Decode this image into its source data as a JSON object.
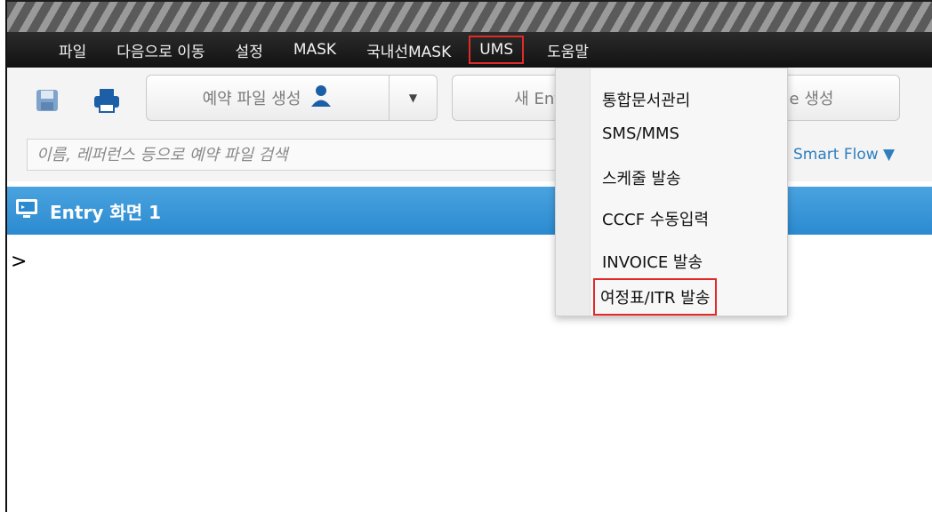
{
  "menubar": {
    "items": [
      "파일",
      "다음으로 이동",
      "설정",
      "MASK",
      "국내선MASK",
      "UMS",
      "도움말"
    ],
    "highlighted": "UMS"
  },
  "toolbar": {
    "reserve_button_label": "예약 파일 생성",
    "new_entry_label": "새 Entr",
    "create_label": "le 생성"
  },
  "search": {
    "placeholder": "이름, 레퍼런스 등으로 예약 파일 검색",
    "smart_flow_label": "Smart Flow ▼"
  },
  "entry": {
    "title": "Entry 화면 1",
    "expander": ">"
  },
  "dropdown": {
    "items": [
      "통합문서관리",
      "SMS/MMS",
      "스케줄 발송",
      "CCCF 수동입력",
      "INVOICE 발송",
      "여정표/ITR 발송"
    ],
    "highlighted": "여정표/ITR 발송"
  },
  "colors": {
    "menubar": "#1a1a1a",
    "header_blue": "#3a97d8",
    "highlight_red": "#e32a2a",
    "link_blue": "#2d7fbf"
  },
  "icons": [
    "save-icon",
    "print-icon",
    "person-icon",
    "caret-down-icon",
    "monitor-icon"
  ]
}
